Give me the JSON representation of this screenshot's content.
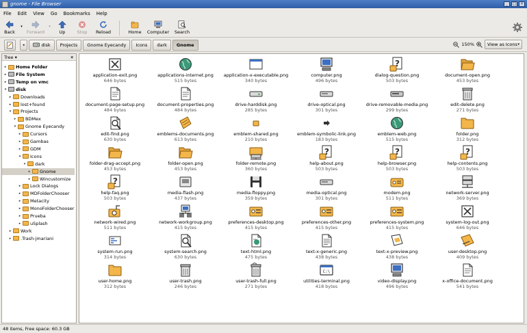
{
  "window": {
    "title": "gnome - File Browser"
  },
  "menubar": [
    "File",
    "Edit",
    "View",
    "Go",
    "Bookmarks",
    "Help"
  ],
  "toolbar": {
    "back": "Back",
    "forward": "Forward",
    "up": "Up",
    "stop": "Stop",
    "reload": "Reload",
    "home": "Home",
    "computer": "Computer",
    "search": "Search"
  },
  "location": {
    "crumbs": [
      "disk",
      "Projects",
      "Gnome Eyecandy",
      "Icons",
      "dark",
      "Gnome"
    ],
    "zoom": "150%",
    "view_as": "View as Icons"
  },
  "sidebar": {
    "mode": "Tree",
    "nodes": [
      {
        "label": "Home Folder",
        "depth": 0,
        "bold": true,
        "type": "folder",
        "open": false
      },
      {
        "label": "File System",
        "depth": 0,
        "bold": true,
        "type": "drive",
        "open": false
      },
      {
        "label": "Temp on vmc",
        "depth": 0,
        "bold": true,
        "type": "drive",
        "open": false
      },
      {
        "label": "disk",
        "depth": 0,
        "bold": true,
        "type": "drive",
        "open": true
      },
      {
        "label": "Downloads",
        "depth": 1,
        "type": "folder",
        "open": false
      },
      {
        "label": "lost+found",
        "depth": 1,
        "type": "folder",
        "open": false
      },
      {
        "label": "Projects",
        "depth": 1,
        "type": "folder",
        "open": true
      },
      {
        "label": "BDMex",
        "depth": 2,
        "type": "folder",
        "open": false
      },
      {
        "label": "Gnome Eyecandy",
        "depth": 2,
        "type": "folder",
        "open": true
      },
      {
        "label": "Cursors",
        "depth": 3,
        "type": "folder",
        "open": false
      },
      {
        "label": "Gambas",
        "depth": 3,
        "type": "folder",
        "open": false
      },
      {
        "label": "GDM",
        "depth": 3,
        "type": "folder",
        "open": false
      },
      {
        "label": "Icons",
        "depth": 3,
        "type": "folder",
        "open": true
      },
      {
        "label": "dark",
        "depth": 4,
        "type": "folder",
        "open": true
      },
      {
        "label": "Gnome",
        "depth": 5,
        "type": "folder",
        "open": false,
        "selected": true
      },
      {
        "label": "Wincustomize",
        "depth": 5,
        "type": "folder",
        "open": false
      },
      {
        "label": "Lock Dialogs",
        "depth": 3,
        "type": "folder",
        "open": false
      },
      {
        "label": "MDFolderChooser",
        "depth": 3,
        "type": "folder",
        "open": false
      },
      {
        "label": "Metacity",
        "depth": 3,
        "type": "folder",
        "open": false
      },
      {
        "label": "MonoFolderChooser",
        "depth": 3,
        "type": "folder",
        "open": false
      },
      {
        "label": "Prueba",
        "depth": 3,
        "type": "folder",
        "open": false
      },
      {
        "label": "uSplash",
        "depth": 3,
        "type": "folder",
        "open": false
      },
      {
        "label": "Work",
        "depth": 1,
        "type": "folder",
        "open": false
      },
      {
        "label": ".Trash-jmariani",
        "depth": 1,
        "type": "folder",
        "open": false
      }
    ]
  },
  "files": [
    {
      "name": "application-exit.png",
      "size": "646 bytes",
      "icon": "exit-icon"
    },
    {
      "name": "applications-internet.png",
      "size": "515 bytes",
      "icon": "globe-icon"
    },
    {
      "name": "application-x-executable.png",
      "size": "340 bytes",
      "icon": "window-icon"
    },
    {
      "name": "computer.png",
      "size": "496 bytes",
      "icon": "monitor-icon"
    },
    {
      "name": "dialog-question.png",
      "size": "503 bytes",
      "icon": "question-icon"
    },
    {
      "name": "document-open.png",
      "size": "453 bytes",
      "icon": "folder-open-icon"
    },
    {
      "name": "document-page-setup.png",
      "size": "484 bytes",
      "icon": "document-icon"
    },
    {
      "name": "document-properties.png",
      "size": "484 bytes",
      "icon": "document-icon"
    },
    {
      "name": "drive-harddisk.png",
      "size": "285 bytes",
      "icon": "harddisk-icon"
    },
    {
      "name": "drive-optical.png",
      "size": "301 bytes",
      "icon": "optical-drive-icon"
    },
    {
      "name": "drive-removable-media.png",
      "size": "299 bytes",
      "icon": "removable-drive-icon"
    },
    {
      "name": "edit-delete.png",
      "size": "271 bytes",
      "icon": "trash-icon"
    },
    {
      "name": "edit-find.png",
      "size": "630 bytes",
      "icon": "find-icon"
    },
    {
      "name": "emblems-documents.png",
      "size": "613 bytes",
      "icon": "emblem-documents-icon"
    },
    {
      "name": "emblem-shared.png",
      "size": "210 bytes",
      "icon": "shared-icon"
    },
    {
      "name": "emblem-symbolic-link.png",
      "size": "183 bytes",
      "icon": "arrow-icon"
    },
    {
      "name": "emblem-web.png",
      "size": "515 bytes",
      "icon": "globe-icon"
    },
    {
      "name": "folder.png",
      "size": "312 bytes",
      "icon": "folder-icon"
    },
    {
      "name": "folder-drag-accept.png",
      "size": "453 bytes",
      "icon": "folder-open-icon"
    },
    {
      "name": "folder-open.png",
      "size": "453 bytes",
      "icon": "folder-open-icon"
    },
    {
      "name": "folder-remote.png",
      "size": "360 bytes",
      "icon": "folder-remote-icon"
    },
    {
      "name": "help-about.png",
      "size": "503 bytes",
      "icon": "question-icon"
    },
    {
      "name": "help-browser.png",
      "size": "503 bytes",
      "icon": "question-icon"
    },
    {
      "name": "help-contents.png",
      "size": "503 bytes",
      "icon": "question-icon"
    },
    {
      "name": "help-faq.png",
      "size": "503 bytes",
      "icon": "question-icon"
    },
    {
      "name": "media-flash.png",
      "size": "437 bytes",
      "icon": "flash-icon"
    },
    {
      "name": "media-floppy.png",
      "size": "359 bytes",
      "icon": "floppy-icon"
    },
    {
      "name": "media-optical.png",
      "size": "301 bytes",
      "icon": "optical-drive-icon"
    },
    {
      "name": "modem.png",
      "size": "511 bytes",
      "icon": "modem-icon"
    },
    {
      "name": "network-server.png",
      "size": "369 bytes",
      "icon": "server-icon"
    },
    {
      "name": "network-wired.png",
      "size": "511 bytes",
      "icon": "network-wired-icon"
    },
    {
      "name": "network-workgroup.png",
      "size": "415 bytes",
      "icon": "workgroup-icon"
    },
    {
      "name": "preferences-desktop.png",
      "size": "415 bytes",
      "icon": "preferences-icon"
    },
    {
      "name": "preferences-other.png",
      "size": "415 bytes",
      "icon": "preferences-icon"
    },
    {
      "name": "preferences-system.png",
      "size": "415 bytes",
      "icon": "preferences-icon"
    },
    {
      "name": "system-log-out.png",
      "size": "646 bytes",
      "icon": "exit-icon"
    },
    {
      "name": "system-run.png",
      "size": "314 bytes",
      "icon": "run-icon"
    },
    {
      "name": "system-search.png",
      "size": "630 bytes",
      "icon": "find-icon"
    },
    {
      "name": "text-html.png",
      "size": "475 bytes",
      "icon": "html-document-icon"
    },
    {
      "name": "text-x-generic.png",
      "size": "438 bytes",
      "icon": "text-document-icon"
    },
    {
      "name": "text-x-preview.png",
      "size": "438 bytes",
      "icon": "preview-document-icon"
    },
    {
      "name": "user-desktop.png",
      "size": "409 bytes",
      "icon": "desktop-icon"
    },
    {
      "name": "user-home.png",
      "size": "312 bytes",
      "icon": "folder-icon"
    },
    {
      "name": "user-trash.png",
      "size": "246 bytes",
      "icon": "trash-icon"
    },
    {
      "name": "user-trash-full.png",
      "size": "271 bytes",
      "icon": "trash-full-icon"
    },
    {
      "name": "utilities-terminal.png",
      "size": "418 bytes",
      "icon": "terminal-icon"
    },
    {
      "name": "video-display.png",
      "size": "496 bytes",
      "icon": "monitor-icon"
    },
    {
      "name": "x-office-document.png",
      "size": "541 bytes",
      "icon": "document-icon"
    }
  ],
  "status": "48 items, Free space: 60.3 GB",
  "colors": {
    "folder": "#f3b64a",
    "folder_border": "#8a5a0c",
    "dark": "#333333",
    "title_bar": "#2e5ea8"
  }
}
